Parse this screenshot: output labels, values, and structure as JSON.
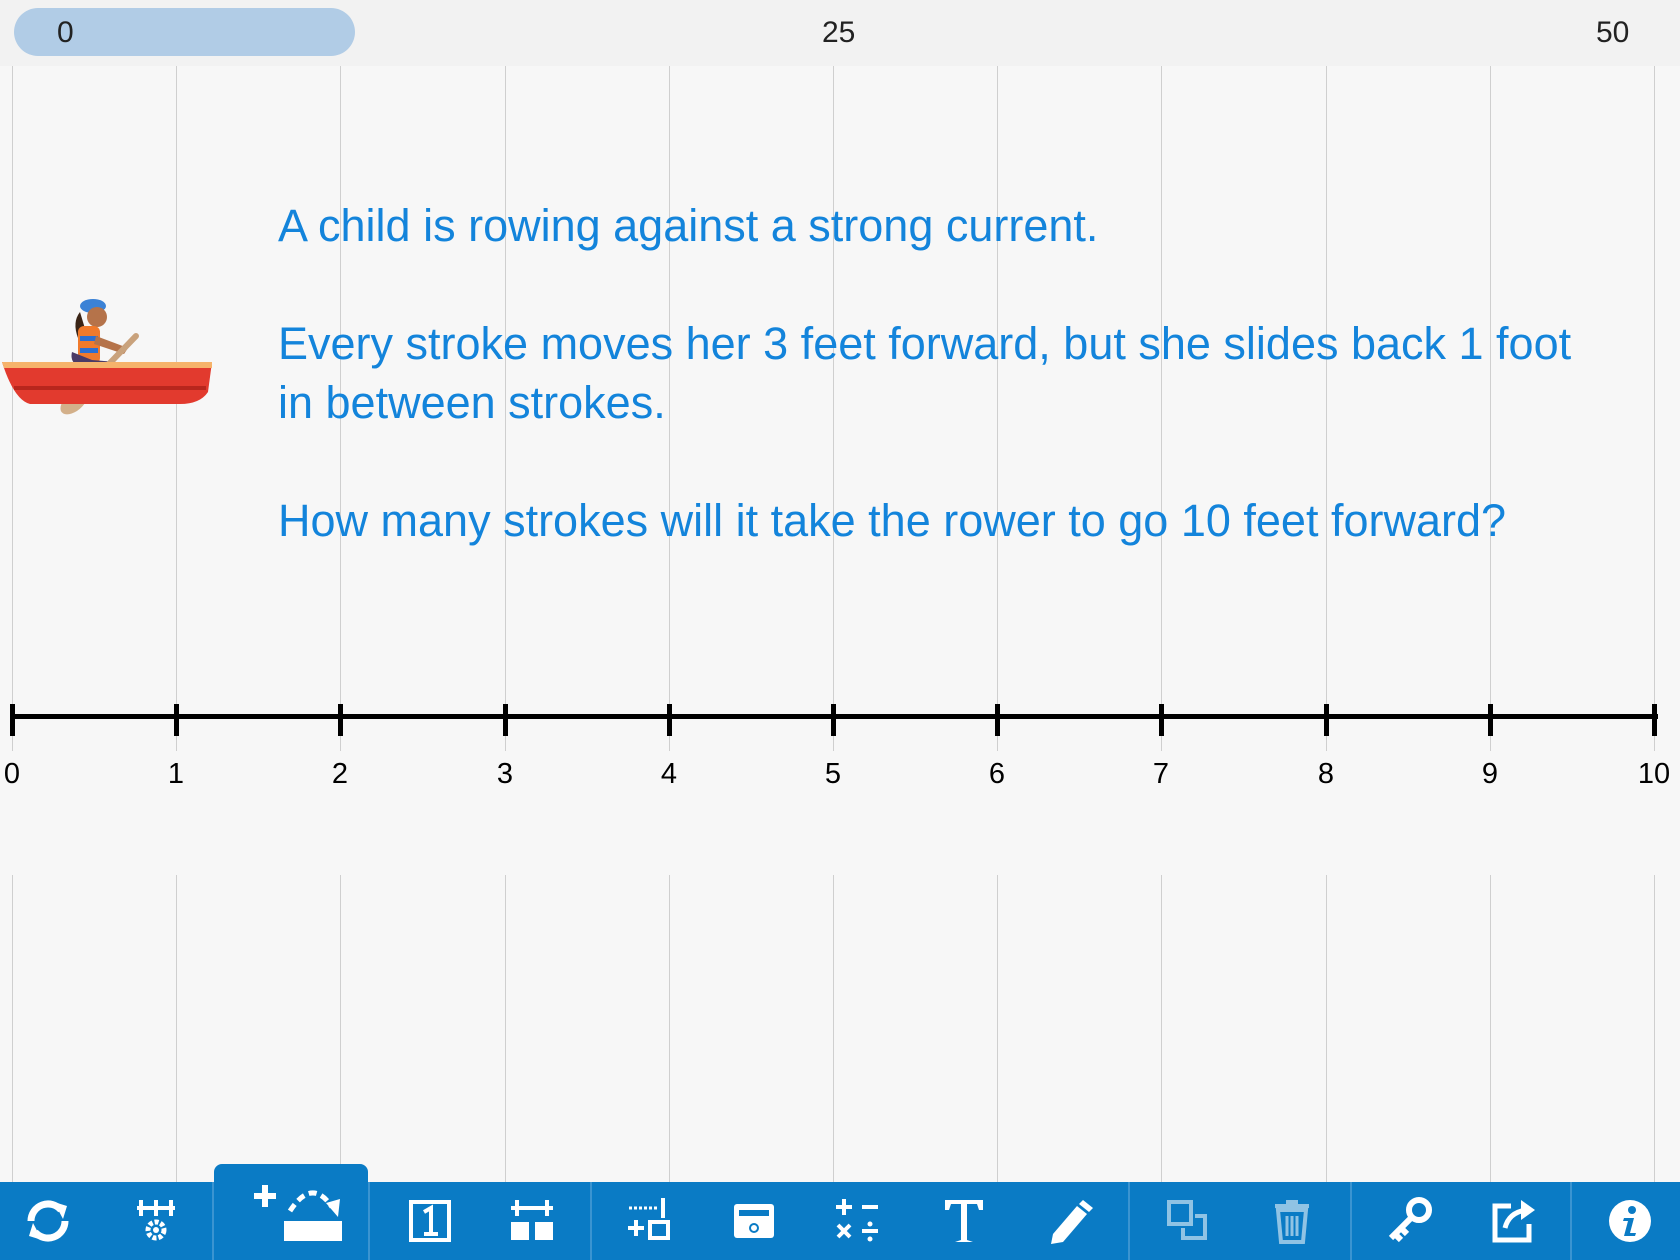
{
  "range_bar": {
    "min_label": "0",
    "mid_label": "25",
    "max_label": "50"
  },
  "number_line": {
    "ticks": [
      "0",
      "1",
      "2",
      "3",
      "4",
      "5",
      "6",
      "7",
      "8",
      "9",
      "10"
    ]
  },
  "prompt": {
    "line1": "A child is rowing against a strong current.",
    "line2": "Every stroke moves her 3 feet forward, but she slides back 1 foot in between strokes.",
    "line3": "How many strokes will it take the rower to go 10 feet forward?"
  },
  "colors": {
    "text_blue": "#1384db",
    "toolbar": "#0a7bc5",
    "range_thumb": "#b1cce6"
  },
  "toolbar": {
    "tools": [
      {
        "name": "refresh-icon"
      },
      {
        "name": "number-line-settings-icon"
      },
      {
        "name": "add-jump-icon",
        "active": true
      },
      {
        "name": "number-box-icon"
      },
      {
        "name": "bars-icon"
      },
      {
        "name": "equation-icon"
      },
      {
        "name": "hide-box-icon"
      },
      {
        "name": "operations-icon"
      },
      {
        "name": "text-icon"
      },
      {
        "name": "pencil-icon"
      },
      {
        "name": "duplicate-icon",
        "disabled": true
      },
      {
        "name": "trash-icon",
        "disabled": true
      },
      {
        "name": "key-icon"
      },
      {
        "name": "share-icon"
      },
      {
        "name": "info-icon"
      }
    ]
  }
}
